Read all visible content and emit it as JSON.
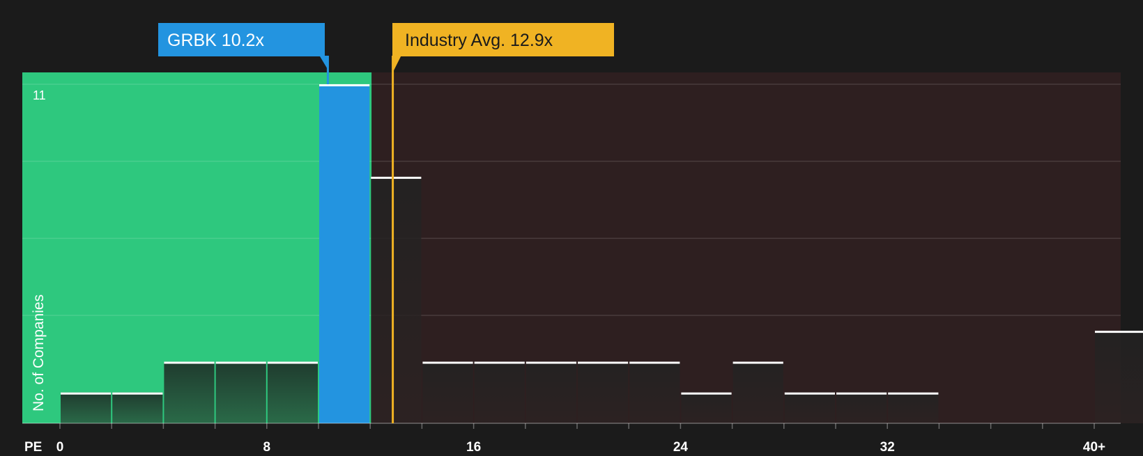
{
  "chart_data": {
    "type": "bar",
    "xlabel": "PE",
    "ylabel": "No. of Companies",
    "y_max_label": "11",
    "ylim": [
      0,
      11.4
    ],
    "x_ticks": [
      "0",
      "8",
      "16",
      "24",
      "32",
      "40+"
    ],
    "x_tick_values": [
      0,
      8,
      16,
      24,
      32,
      40
    ],
    "bin_width": 2,
    "bins": [
      {
        "start": 0,
        "value": 1
      },
      {
        "start": 2,
        "value": 1
      },
      {
        "start": 4,
        "value": 2
      },
      {
        "start": 6,
        "value": 2
      },
      {
        "start": 8,
        "value": 2
      },
      {
        "start": 10,
        "value": 11
      },
      {
        "start": 12,
        "value": 8
      },
      {
        "start": 14,
        "value": 2
      },
      {
        "start": 16,
        "value": 2
      },
      {
        "start": 18,
        "value": 2
      },
      {
        "start": 20,
        "value": 2
      },
      {
        "start": 22,
        "value": 2
      },
      {
        "start": 24,
        "value": 1
      },
      {
        "start": 26,
        "value": 2
      },
      {
        "start": 28,
        "value": 1
      },
      {
        "start": 30,
        "value": 1
      },
      {
        "start": 32,
        "value": 1
      },
      {
        "start": 34,
        "value": 0
      },
      {
        "start": 36,
        "value": 0
      },
      {
        "start": 38,
        "value": 0
      },
      {
        "start": 40,
        "value": 3
      }
    ],
    "company": {
      "label": "GRBK 10.2x",
      "value": 10.2,
      "color": "#2394e0"
    },
    "industry_avg": {
      "label": "Industry Avg. 12.9x",
      "value": 12.9,
      "color": "#f0b323"
    },
    "colors": {
      "background": "#1b1b1b",
      "undervalued_zone": "#2ec87e",
      "overvalued_zone": "#2e1f20",
      "bar_fill": "#202020",
      "bar_top": "#ffffff"
    },
    "grid": true
  }
}
